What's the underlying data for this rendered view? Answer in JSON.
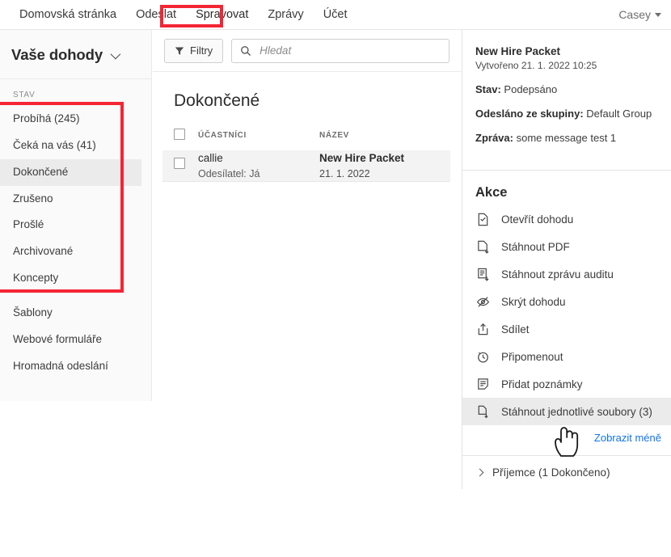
{
  "topnav": {
    "items": [
      {
        "label": "Domovská stránka",
        "active": false
      },
      {
        "label": "Odeslat",
        "active": false
      },
      {
        "label": "Spravovat",
        "active": true
      },
      {
        "label": "Zprávy",
        "active": false
      },
      {
        "label": "Účet",
        "active": false
      }
    ],
    "user": "Casey"
  },
  "sidebar": {
    "title": "Vaše dohody",
    "section_label": "STAV",
    "status_items": [
      {
        "label": "Probíhá (245)",
        "selected": false
      },
      {
        "label": "Čeká na vás (41)",
        "selected": false
      },
      {
        "label": "Dokončené",
        "selected": true
      },
      {
        "label": "Zrušeno",
        "selected": false
      },
      {
        "label": "Prošlé",
        "selected": false
      },
      {
        "label": "Archivované",
        "selected": false
      },
      {
        "label": "Koncepty",
        "selected": false
      }
    ],
    "other_items": [
      {
        "label": "Šablony"
      },
      {
        "label": "Webové formuláře"
      },
      {
        "label": "Hromadná odeslání"
      }
    ]
  },
  "toolbar": {
    "filters_label": "Filtry",
    "search_placeholder": "Hledat",
    "search_value": ""
  },
  "list": {
    "title": "Dokončené",
    "columns": [
      "ÚČASTNÍCI",
      "NÁZEV"
    ],
    "rows": [
      {
        "participant": "callie",
        "sender": "Odesílatel: Já",
        "name": "New Hire Packet",
        "date": "21. 1. 2022"
      }
    ]
  },
  "detail": {
    "title": "New Hire Packet",
    "created": "Vytvořeno 21. 1. 2022 10:25",
    "status_key": "Stav:",
    "status_value": "Podepsáno",
    "group_key": "Odesláno ze skupiny:",
    "group_value": "Default Group",
    "message_key": "Zpráva:",
    "message_value": "some message test 1",
    "actions_title": "Akce",
    "actions": [
      {
        "label": "Otevřít dohodu",
        "icon": "open-document-icon",
        "hovered": false
      },
      {
        "label": "Stáhnout PDF",
        "icon": "download-pdf-icon",
        "hovered": false
      },
      {
        "label": "Stáhnout zprávu auditu",
        "icon": "audit-report-icon",
        "hovered": false
      },
      {
        "label": "Skrýt dohodu",
        "icon": "hide-eye-icon",
        "hovered": false
      },
      {
        "label": "Sdílet",
        "icon": "share-icon",
        "hovered": false
      },
      {
        "label": "Připomenout",
        "icon": "clock-reminder-icon",
        "hovered": false
      },
      {
        "label": "Přidat poznámky",
        "icon": "add-notes-icon",
        "hovered": false
      },
      {
        "label": "Stáhnout jednotlivé soubory (3)",
        "icon": "download-files-icon",
        "hovered": true
      }
    ],
    "show_less": "Zobrazit méně",
    "recipients": "Příjemce (1 Dokončeno)"
  },
  "colors": {
    "annotation_red": "#f42534",
    "link_blue": "#1473e6",
    "sidebar_bg": "#fafafa",
    "selected_bg": "#ebebeb",
    "row_bg": "#f3f3f3"
  }
}
